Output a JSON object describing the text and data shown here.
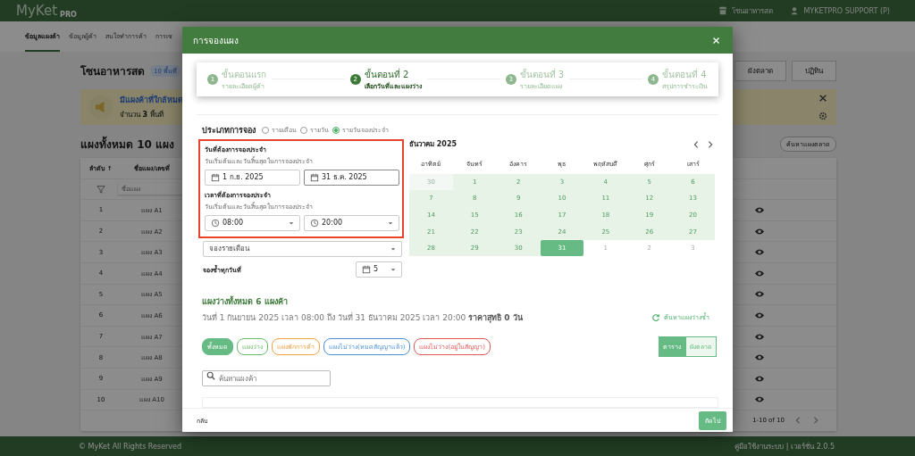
{
  "app_header": {
    "logo": "MyKet",
    "logo_sub": "PRO",
    "zone": "โซนอาหารสด",
    "user": "MYKETPRO SUPPORT (P)"
  },
  "nav_tabs": [
    {
      "label": "ข้อมูลแผงค้า",
      "selected": true
    },
    {
      "label": "ข้อมูลผู้ค้า",
      "selected": false
    },
    {
      "label": "สนใจทำการค้า",
      "selected": false
    },
    {
      "label": "การเช",
      "selected": false
    }
  ],
  "zone": {
    "title": "โซนอาหารสด",
    "badge": "10 พื้นที่",
    "view_buttons": [
      {
        "label": "ผังตลาด"
      },
      {
        "label": "ปฏิทิน"
      }
    ]
  },
  "alert": {
    "title": "มีแผงค้าที่ใกล้หมด",
    "count_text": "จำนวน **3** พื้นที่"
  },
  "stalls": {
    "title": "แผงทั้งหมด 10 แผง",
    "action": "ค้นหาแผงตลาด",
    "columns": [
      "ลำดับ ↑",
      "ชื่อแผง/เลขที่"
    ],
    "filter_placeholder": "ชื่อแผง",
    "rows": [
      {
        "no": "1",
        "name": "แผง A1"
      },
      {
        "no": "2",
        "name": "แผง A2"
      },
      {
        "no": "3",
        "name": "แผง A3"
      },
      {
        "no": "4",
        "name": "แผง A4"
      },
      {
        "no": "5",
        "name": "แผง A5"
      },
      {
        "no": "6",
        "name": "แผง A6"
      },
      {
        "no": "7",
        "name": "แผง A7"
      },
      {
        "no": "8",
        "name": "แผง A8"
      },
      {
        "no": "9",
        "name": "แผง A9"
      },
      {
        "no": "10",
        "name": "แผง A10"
      }
    ],
    "pagination": "1-10 of 10"
  },
  "footer": {
    "copyright": "© MyKet All Rights Reserved",
    "links": "คู่มือใช้งานระบบ | เวอร์ชั่น 2.0.5"
  },
  "dialog": {
    "title": "การจองแผง",
    "steps": [
      {
        "number": "1",
        "title": "ขั้นตอนแรก",
        "subtitle": "รายละเอียดผู้ค้า",
        "selected": false
      },
      {
        "number": "2",
        "title": "ขั้นตอนที่ 2",
        "subtitle": "เลือกวันที่และแผงว่าง",
        "selected": true
      },
      {
        "number": "3",
        "title": "ขั้นตอนที่ 3",
        "subtitle": "รายละเอียดแผง",
        "selected": false
      },
      {
        "number": "4",
        "title": "ขั้นตอนที่ 4",
        "subtitle": "สรุปการชำระเงิน",
        "selected": false
      }
    ],
    "booking_type": {
      "label": "ประเภทการจอง",
      "options": [
        {
          "label": "รายเดือน",
          "selected": false
        },
        {
          "label": "รายวัน",
          "selected": false
        },
        {
          "label": "รายวันจองประจำ",
          "selected": true
        }
      ]
    },
    "highlighted": true,
    "date_range": {
      "label": "วันที่ต้องการจองประจำ",
      "hint": "วันเริ่มต้นและวันสิ้นสุดในการจองประจำ",
      "start": "1 ก.ย. 2025",
      "end": "31 ธ.ค. 2025"
    },
    "time_range": {
      "label": "เวลาที่ต้องการจองประจำ",
      "hint": "วันเริ่มต้นและวันสิ้นสุดในการจองประจำ",
      "start": "08:00",
      "end": "20:00"
    },
    "repeat_mode": "จองรายเดือน",
    "repeat_day": {
      "label": "จองซ้ำทุกวันที่",
      "value": "5"
    },
    "calendar": {
      "month": "ธันวาคม 2025",
      "weekdays": [
        "อาทิตย์",
        "จันทร์",
        "อังคาร",
        "พุธ",
        "พฤหัสบดี",
        "ศุกร์",
        "เสาร์"
      ],
      "days": [
        {
          "label": "30",
          "outside": true,
          "in_range": true,
          "selected": false
        },
        {
          "label": "1",
          "outside": false,
          "in_range": true,
          "selected": false
        },
        {
          "label": "2",
          "outside": false,
          "in_range": true,
          "selected": false
        },
        {
          "label": "3",
          "outside": false,
          "in_range": true,
          "selected": false
        },
        {
          "label": "4",
          "outside": false,
          "in_range": true,
          "selected": false
        },
        {
          "label": "5",
          "outside": false,
          "in_range": true,
          "selected": false
        },
        {
          "label": "6",
          "outside": false,
          "in_range": true,
          "selected": false
        },
        {
          "label": "7",
          "outside": false,
          "in_range": true,
          "selected": false
        },
        {
          "label": "8",
          "outside": false,
          "in_range": true,
          "selected": false
        },
        {
          "label": "9",
          "outside": false,
          "in_range": true,
          "selected": false
        },
        {
          "label": "10",
          "outside": false,
          "in_range": true,
          "selected": false
        },
        {
          "label": "11",
          "outside": false,
          "in_range": true,
          "selected": false
        },
        {
          "label": "12",
          "outside": false,
          "in_range": true,
          "selected": false
        },
        {
          "label": "13",
          "outside": false,
          "in_range": true,
          "selected": false
        },
        {
          "label": "14",
          "outside": false,
          "in_range": true,
          "selected": false
        },
        {
          "label": "15",
          "outside": false,
          "in_range": true,
          "selected": false
        },
        {
          "label": "16",
          "outside": false,
          "in_range": true,
          "selected": false
        },
        {
          "label": "17",
          "outside": false,
          "in_range": true,
          "selected": false
        },
        {
          "label": "18",
          "outside": false,
          "in_range": true,
          "selected": false
        },
        {
          "label": "19",
          "outside": false,
          "in_range": true,
          "selected": false
        },
        {
          "label": "20",
          "outside": false,
          "in_range": true,
          "selected": false
        },
        {
          "label": "21",
          "outside": false,
          "in_range": true,
          "selected": false
        },
        {
          "label": "22",
          "outside": false,
          "in_range": true,
          "selected": false
        },
        {
          "label": "23",
          "outside": false,
          "in_range": true,
          "selected": false
        },
        {
          "label": "24",
          "outside": false,
          "in_range": true,
          "selected": false
        },
        {
          "label": "25",
          "outside": false,
          "in_range": true,
          "selected": false
        },
        {
          "label": "26",
          "outside": false,
          "in_range": true,
          "selected": false
        },
        {
          "label": "27",
          "outside": false,
          "in_range": true,
          "selected": false
        },
        {
          "label": "28",
          "outside": false,
          "in_range": true,
          "selected": false
        },
        {
          "label": "29",
          "outside": false,
          "in_range": true,
          "selected": false
        },
        {
          "label": "30",
          "outside": false,
          "in_range": true,
          "selected": false
        },
        {
          "label": "31",
          "outside": false,
          "in_range": true,
          "selected": true
        },
        {
          "label": "1",
          "outside": true,
          "in_range": false,
          "selected": false
        },
        {
          "label": "2",
          "outside": true,
          "in_range": false,
          "selected": false
        },
        {
          "label": "3",
          "outside": true,
          "in_range": false,
          "selected": false
        }
      ]
    },
    "available": {
      "title": "แผงว่างทั้งหมด 6 แผงค้า",
      "summary": "วันที่ 1 กันยายน 2025 เวลา 08:00 ถึง วันที่ 31 ธันวาคม 2025 เวลา 20:00 **ราคาสุทธิ 0 วัน**",
      "refresh": "ค้นหาแผงว่างซ้ำ",
      "filters": [
        {
          "label": "ทั้งหมด",
          "color": "#66bb84",
          "selected": true
        },
        {
          "label": "แผงว่าง",
          "color": "#66bb6a",
          "selected": false
        },
        {
          "label": "แผงพักการค้า",
          "color": "#f0a040",
          "selected": false
        },
        {
          "label": "แผงไม่ว่าง(หมดสัญญาแล้ว)",
          "color": "#4a90d9",
          "selected": false
        },
        {
          "label": "แผงไม่ว่าง(อยู่ในสัญญา)",
          "color": "#e05555",
          "selected": false
        }
      ],
      "views": [
        {
          "label": "ตาราง",
          "selected": true
        },
        {
          "label": "ผังตลาด",
          "selected": false
        }
      ],
      "search_placeholder": "ค้นหาแผงค้า"
    },
    "actions": {
      "back": "กลับ",
      "next": "ถัดไป"
    }
  }
}
